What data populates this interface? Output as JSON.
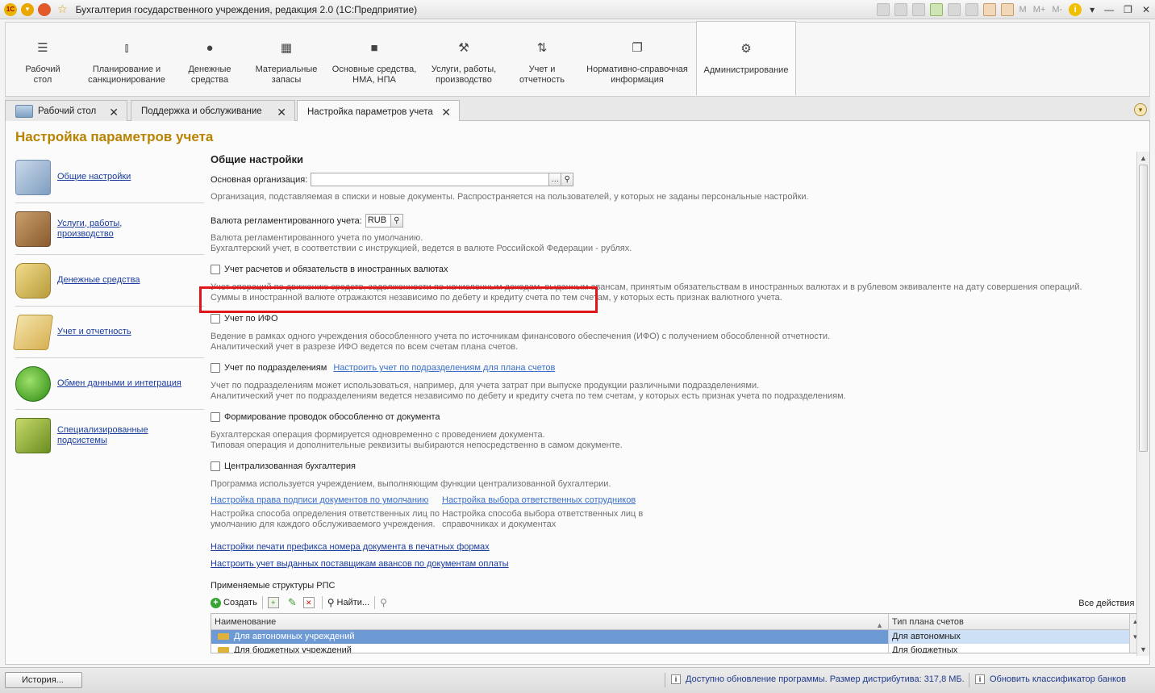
{
  "window": {
    "title": "Бухгалтерия государственного учреждения, редакция 2.0  (1С:Предприятие)",
    "logo": "1С",
    "memory_buttons": [
      "M",
      "M+",
      "M-"
    ]
  },
  "sections": [
    {
      "label": "Рабочий стол",
      "icon": "menu-icon"
    },
    {
      "label": "Планирование и санкционирование",
      "icon": "chart-icon"
    },
    {
      "label": "Денежные средства",
      "icon": "coin-icon"
    },
    {
      "label": "Материальные запасы",
      "icon": "grid-icon"
    },
    {
      "label": "Основные средства, НМА, НПА",
      "icon": "truck-icon"
    },
    {
      "label": "Услуги, работы, производство",
      "icon": "tools-icon"
    },
    {
      "label": "Учет и отчетность",
      "icon": "ledger-icon"
    },
    {
      "label": "Нормативно-справочная информация",
      "icon": "documents-icon"
    },
    {
      "label": "Администрирование",
      "icon": "gear-icon"
    }
  ],
  "tabs": [
    {
      "label": "Рабочий стол"
    },
    {
      "label": "Поддержка и обслуживание"
    },
    {
      "label": "Настройка параметров учета"
    }
  ],
  "page": {
    "title": "Настройка параметров учета"
  },
  "nav": [
    {
      "label": "Общие настройки"
    },
    {
      "label": "Услуги, работы, производство"
    },
    {
      "label": "Денежные средства"
    },
    {
      "label": "Учет и отчетность"
    },
    {
      "label": "Обмен данными и интеграция"
    },
    {
      "label": "Специализированные подсистемы"
    }
  ],
  "general": {
    "heading": "Общие настройки",
    "org_label": "Основная организация:",
    "org_value": "",
    "org_desc": "Организация, подставляемая в списки и новые документы. Распространяется на пользователей, у которых не заданы персональные настройки.",
    "currency_label": "Валюта регламентированного учета:",
    "currency_value": "RUB",
    "currency_desc1": "Валюта регламентированного учета по умолчанию.",
    "currency_desc2": "Бухгалтерский учет, в соответствии с инструкцией, ведется в валюте Российской Федерации - рублях.",
    "opt_foreign": "Учет расчетов и обязательств в иностранных валютах",
    "opt_foreign_desc1": "Учет операций по движению средств, задолженности по начисленным доходам, выданным авансам, принятым обязательствам в иностранных валютах и в рублевом эквиваленте на дату совершения операций.",
    "opt_foreign_desc2": "Суммы в иностранной валюте отражаются независимо по дебету и кредиту счета по тем счетам, у которых есть признак валютного учета.",
    "opt_ifo": "Учет по ИФО",
    "opt_ifo_desc1": "Ведение в рамках одного учреждения обособленного учета по источникам финансового обеспечения (ИФО) с получением обособленной отчетности.",
    "opt_ifo_desc2": "Аналитический учет в разрезе ИФО ведется по всем счетам плана счетов.",
    "opt_dept": "Учет по подразделениям",
    "opt_dept_link": "Настроить учет по подразделениям для плана счетов",
    "opt_dept_desc1": "Учет по подразделениям может использоваться, например, для учета затрат при выпуске продукции различными подразделениями.",
    "opt_dept_desc2": "Аналитический учет по подразделениям ведется независимо по дебету и кредиту счета по тем счетам, у которых есть признак учета по подразделениям.",
    "opt_entries": "Формирование проводок обособленно от документа",
    "opt_entries_desc1": "Бухгалтерская операция формируется одновременно с проведением документа.",
    "opt_entries_desc2": "Типовая операция и дополнительные реквизиты выбираются непосредственно в самом документе.",
    "opt_central": "Централизованная бухгалтерия",
    "opt_central_desc": "Программа используется учреждением, выполняющим функции централизованной бухгалтерии.",
    "link_sign": "Настройка права подписи документов по умолчанию",
    "link_sign_desc1": "Настройка способа определения ответственных лиц по",
    "link_sign_desc2": "умолчанию для каждого обслуживаемого учреждения.",
    "link_resp": "Настройка выбора ответственных сотрудников",
    "link_resp_desc1": "Настройка способа выбора ответственных лиц в",
    "link_resp_desc2": "справочниках и документах",
    "link_prefix": "Настройки печати префикса номера документа в печатных формах",
    "link_advances": "Настроить учет выданных поставщикам авансов по документам оплаты",
    "rps_heading": "Применяемые структуры РПС"
  },
  "toolbar": {
    "create": "Создать",
    "find": "Найти...",
    "all_actions": "Все действия"
  },
  "table": {
    "columns": [
      "Наименование",
      "Тип плана счетов"
    ],
    "rows": [
      {
        "name": "Для автономных учреждений",
        "type": "Для автономных"
      },
      {
        "name": "Для бюджетных учреждений",
        "type": "Для бюджетных"
      }
    ]
  },
  "status": {
    "history": "История...",
    "update_msg": "Доступно обновление программы. Размер дистрибутива: 317,8 МБ.",
    "bank_msg": "Обновить классификатор банков"
  }
}
